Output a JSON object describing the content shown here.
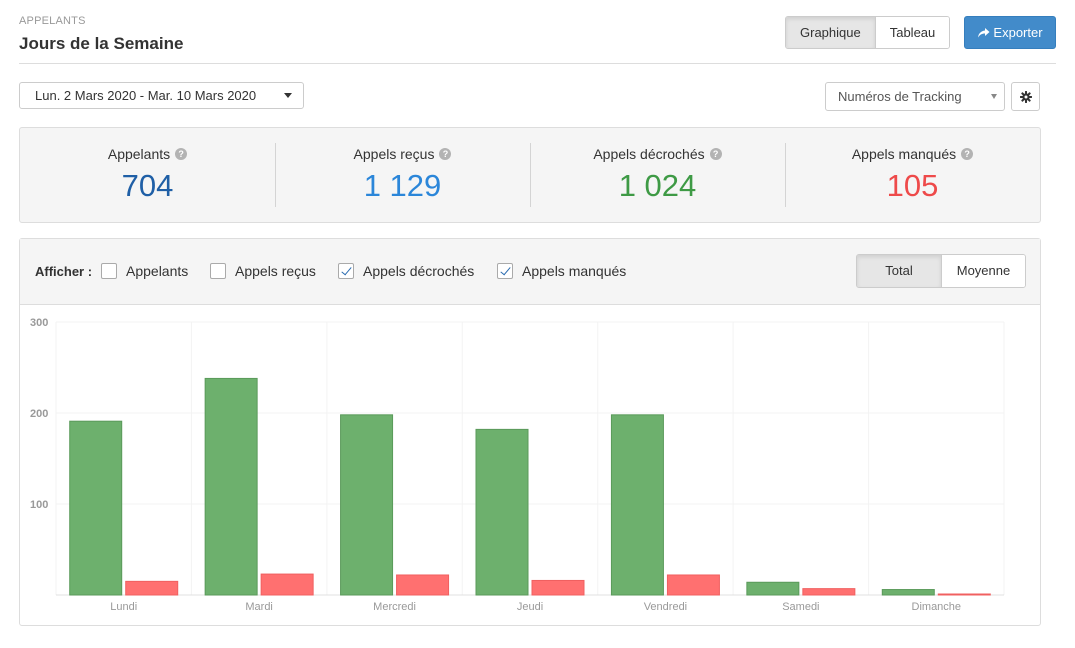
{
  "header": {
    "eyebrow": "APPELANTS",
    "title": "Jours de la Semaine",
    "view_tabs": [
      {
        "label": "Graphique",
        "active": true
      },
      {
        "label": "Tableau",
        "active": false
      }
    ],
    "export_label": "Exporter",
    "export_color": "#428bca"
  },
  "filters": {
    "date_range": "Lun. 2 Mars 2020 - Mar. 10 Mars 2020",
    "tracking_select": "Numéros de Tracking"
  },
  "stats": [
    {
      "label": "Appelants",
      "value": "704",
      "color": "#1f5fa6"
    },
    {
      "label": "Appels reçus",
      "value": "1 129",
      "color": "#2b86d9"
    },
    {
      "label": "Appels décrochés",
      "value": "1 024",
      "color": "#3e9a45"
    },
    {
      "label": "Appels manqués",
      "value": "105",
      "color": "#ee4a4a"
    }
  ],
  "chart_controls": {
    "show_label": "Afficher :",
    "series_toggles": [
      {
        "label": "Appelants",
        "checked": false
      },
      {
        "label": "Appels reçus",
        "checked": false
      },
      {
        "label": "Appels décrochés",
        "checked": true
      },
      {
        "label": "Appels manqués",
        "checked": true
      }
    ],
    "aggregation": [
      {
        "label": "Total",
        "active": true
      },
      {
        "label": "Moyenne",
        "active": false
      }
    ]
  },
  "chart_data": {
    "type": "bar",
    "categories": [
      "Lundi",
      "Mardi",
      "Mercredi",
      "Jeudi",
      "Vendredi",
      "Samedi",
      "Dimanche"
    ],
    "series": [
      {
        "name": "Appels décrochés",
        "color": "#6db06d",
        "values": [
          191,
          238,
          198,
          182,
          198,
          14,
          6
        ]
      },
      {
        "name": "Appels manqués",
        "color": "#ff7070",
        "values": [
          15,
          23,
          22,
          16,
          22,
          7,
          1
        ]
      }
    ],
    "ylim": [
      0,
      300
    ],
    "yticks": [
      100,
      200,
      300
    ],
    "xlabel": "",
    "ylabel": "",
    "grid": true,
    "legend": "none"
  }
}
